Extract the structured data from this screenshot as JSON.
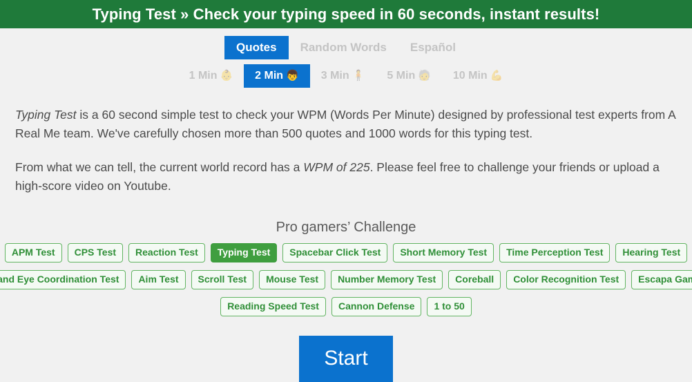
{
  "header": {
    "title": "Typing Test » Check your typing speed in 60 seconds, instant results!",
    "bg_color": "#1f7a3a"
  },
  "mode_tabs": {
    "items": [
      {
        "label": "Quotes",
        "active": true
      },
      {
        "label": "Random Words",
        "active": false
      },
      {
        "label": "Español",
        "active": false
      }
    ],
    "active_color": "#0b72ce",
    "inactive_color": "#c4c4c4"
  },
  "duration_tabs": {
    "items": [
      {
        "label": "1 Min",
        "emoji": "👶",
        "emoji_name": "baby-emoji",
        "active": false
      },
      {
        "label": "2 Min",
        "emoji": "👦",
        "emoji_name": "boy-emoji",
        "active": true
      },
      {
        "label": "3 Min",
        "emoji": "🧍",
        "emoji_name": "person-standing-emoji",
        "active": false
      },
      {
        "label": "5 Min",
        "emoji": "🧓",
        "emoji_name": "older-person-emoji",
        "active": false
      },
      {
        "label": "10 Min",
        "emoji": "💪",
        "emoji_name": "flexed-biceps-emoji",
        "active": false
      }
    ]
  },
  "intro": {
    "p1_lead": "Typing Test",
    "p1_rest": " is a 60 second simple test to check your WPM (Words Per Minute) designed by professional test experts from A Real Me team. We've carefully chosen more than 500 quotes and 1000 words for this typing test.",
    "p2_before": "From what we can tell, the current world record has a ",
    "p2_em": "WPM of 225",
    "p2_after": ". Please feel free to challenge your friends or upload a high-score video on Youtube."
  },
  "challenge": {
    "title": "Pro gamers’ Challenge",
    "rows": [
      [
        {
          "label": "APM Test",
          "active": false
        },
        {
          "label": "CPS Test",
          "active": false
        },
        {
          "label": "Reaction Test",
          "active": false
        },
        {
          "label": "Typing Test",
          "active": true
        },
        {
          "label": "Spacebar Click Test",
          "active": false
        },
        {
          "label": "Short Memory Test",
          "active": false
        },
        {
          "label": "Time Perception Test",
          "active": false
        },
        {
          "label": "Hearing Test",
          "active": false
        }
      ],
      [
        {
          "label": "Hand Eye Coordination Test",
          "active": false
        },
        {
          "label": "Aim Test",
          "active": false
        },
        {
          "label": "Scroll Test",
          "active": false
        },
        {
          "label": "Mouse Test",
          "active": false
        },
        {
          "label": "Number Memory Test",
          "active": false
        },
        {
          "label": "Coreball",
          "active": false
        },
        {
          "label": "Color Recognition Test",
          "active": false
        },
        {
          "label": "Escapa Game",
          "active": false
        }
      ],
      [
        {
          "label": "Reading Speed Test",
          "active": false
        },
        {
          "label": "Cannon Defense",
          "active": false
        },
        {
          "label": "1 to 50",
          "active": false
        }
      ]
    ],
    "pill_border_color": "#62b462",
    "pill_text_color": "#2f8f37",
    "pill_active_bg": "#3f9e3f"
  },
  "start": {
    "label": "Start",
    "bg_color": "#0b72ce"
  }
}
